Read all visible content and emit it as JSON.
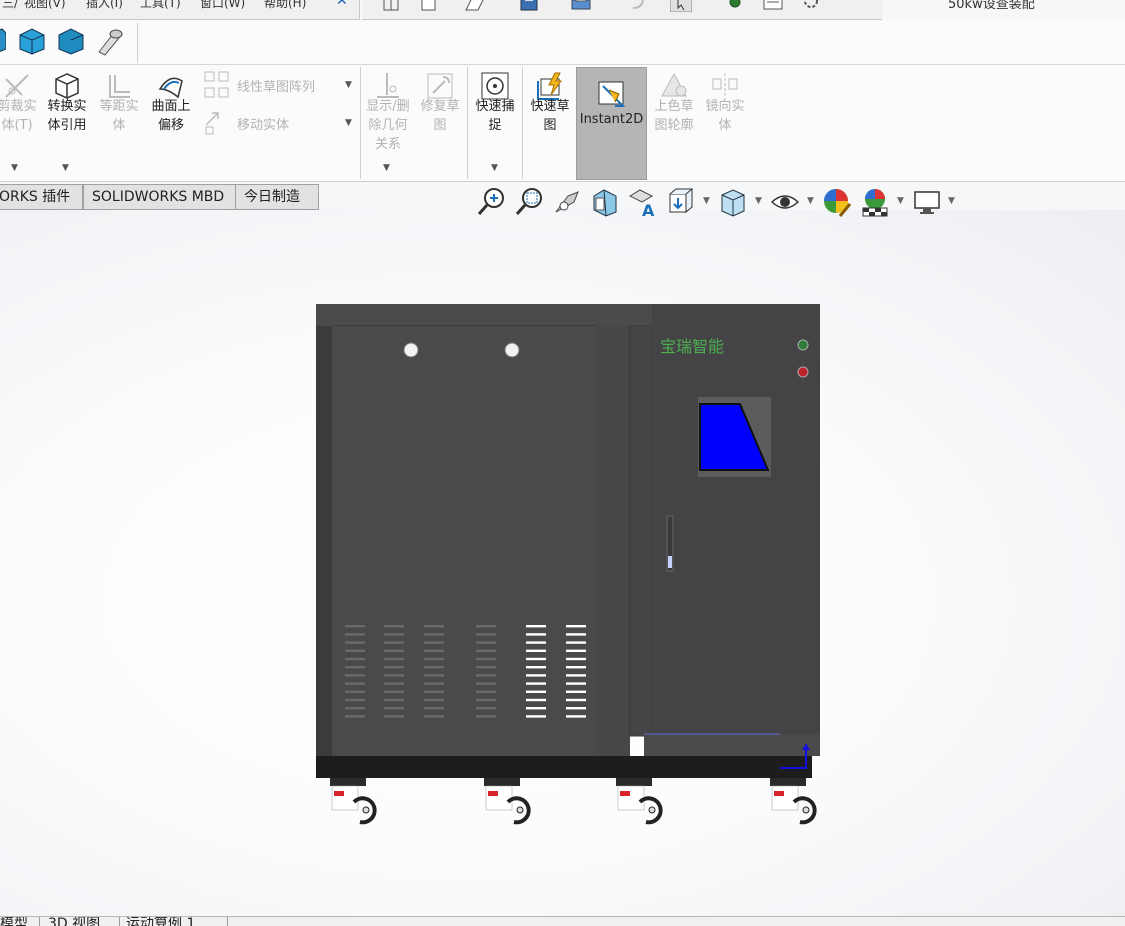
{
  "menu": {
    "items": [
      "三/",
      "视图(V)",
      "插入(I)",
      "工具(T)",
      "窗口(W)",
      "帮助(H)"
    ],
    "close_label": "✕"
  },
  "document": {
    "title": "50kw设查装配"
  },
  "ribbon": {
    "trim": "剪裁实体(T)",
    "convert": "转换实体引用",
    "offset": "等距实体",
    "surface_offset": "曲面上偏移",
    "linear_pattern": "线性草图阵列",
    "move_entities": "移动实体",
    "display_delete": "显示/删除几何关系",
    "repair_sketch": "修复草图",
    "quick_snap": "快速捕捉",
    "rapid_sketch": "快速草图",
    "instant2d": "Instant2D",
    "shaded_sketch": "上色草图轮廓",
    "mirror": "镜向实体"
  },
  "tabs": {
    "addins": "ORKS 插件",
    "mbd": "SOLIDWORKS MBD",
    "today": "今日制造"
  },
  "model": {
    "brand_text": "宝瑞智能",
    "screen_color": "#0000ff",
    "cabinet_color": "#444446",
    "indicator_green": "#2f7d3a",
    "indicator_red": "#c0232b"
  },
  "bottom_tabs": {
    "model": "模型",
    "view3d": "3D 视图",
    "motion": "运动算例 1"
  }
}
